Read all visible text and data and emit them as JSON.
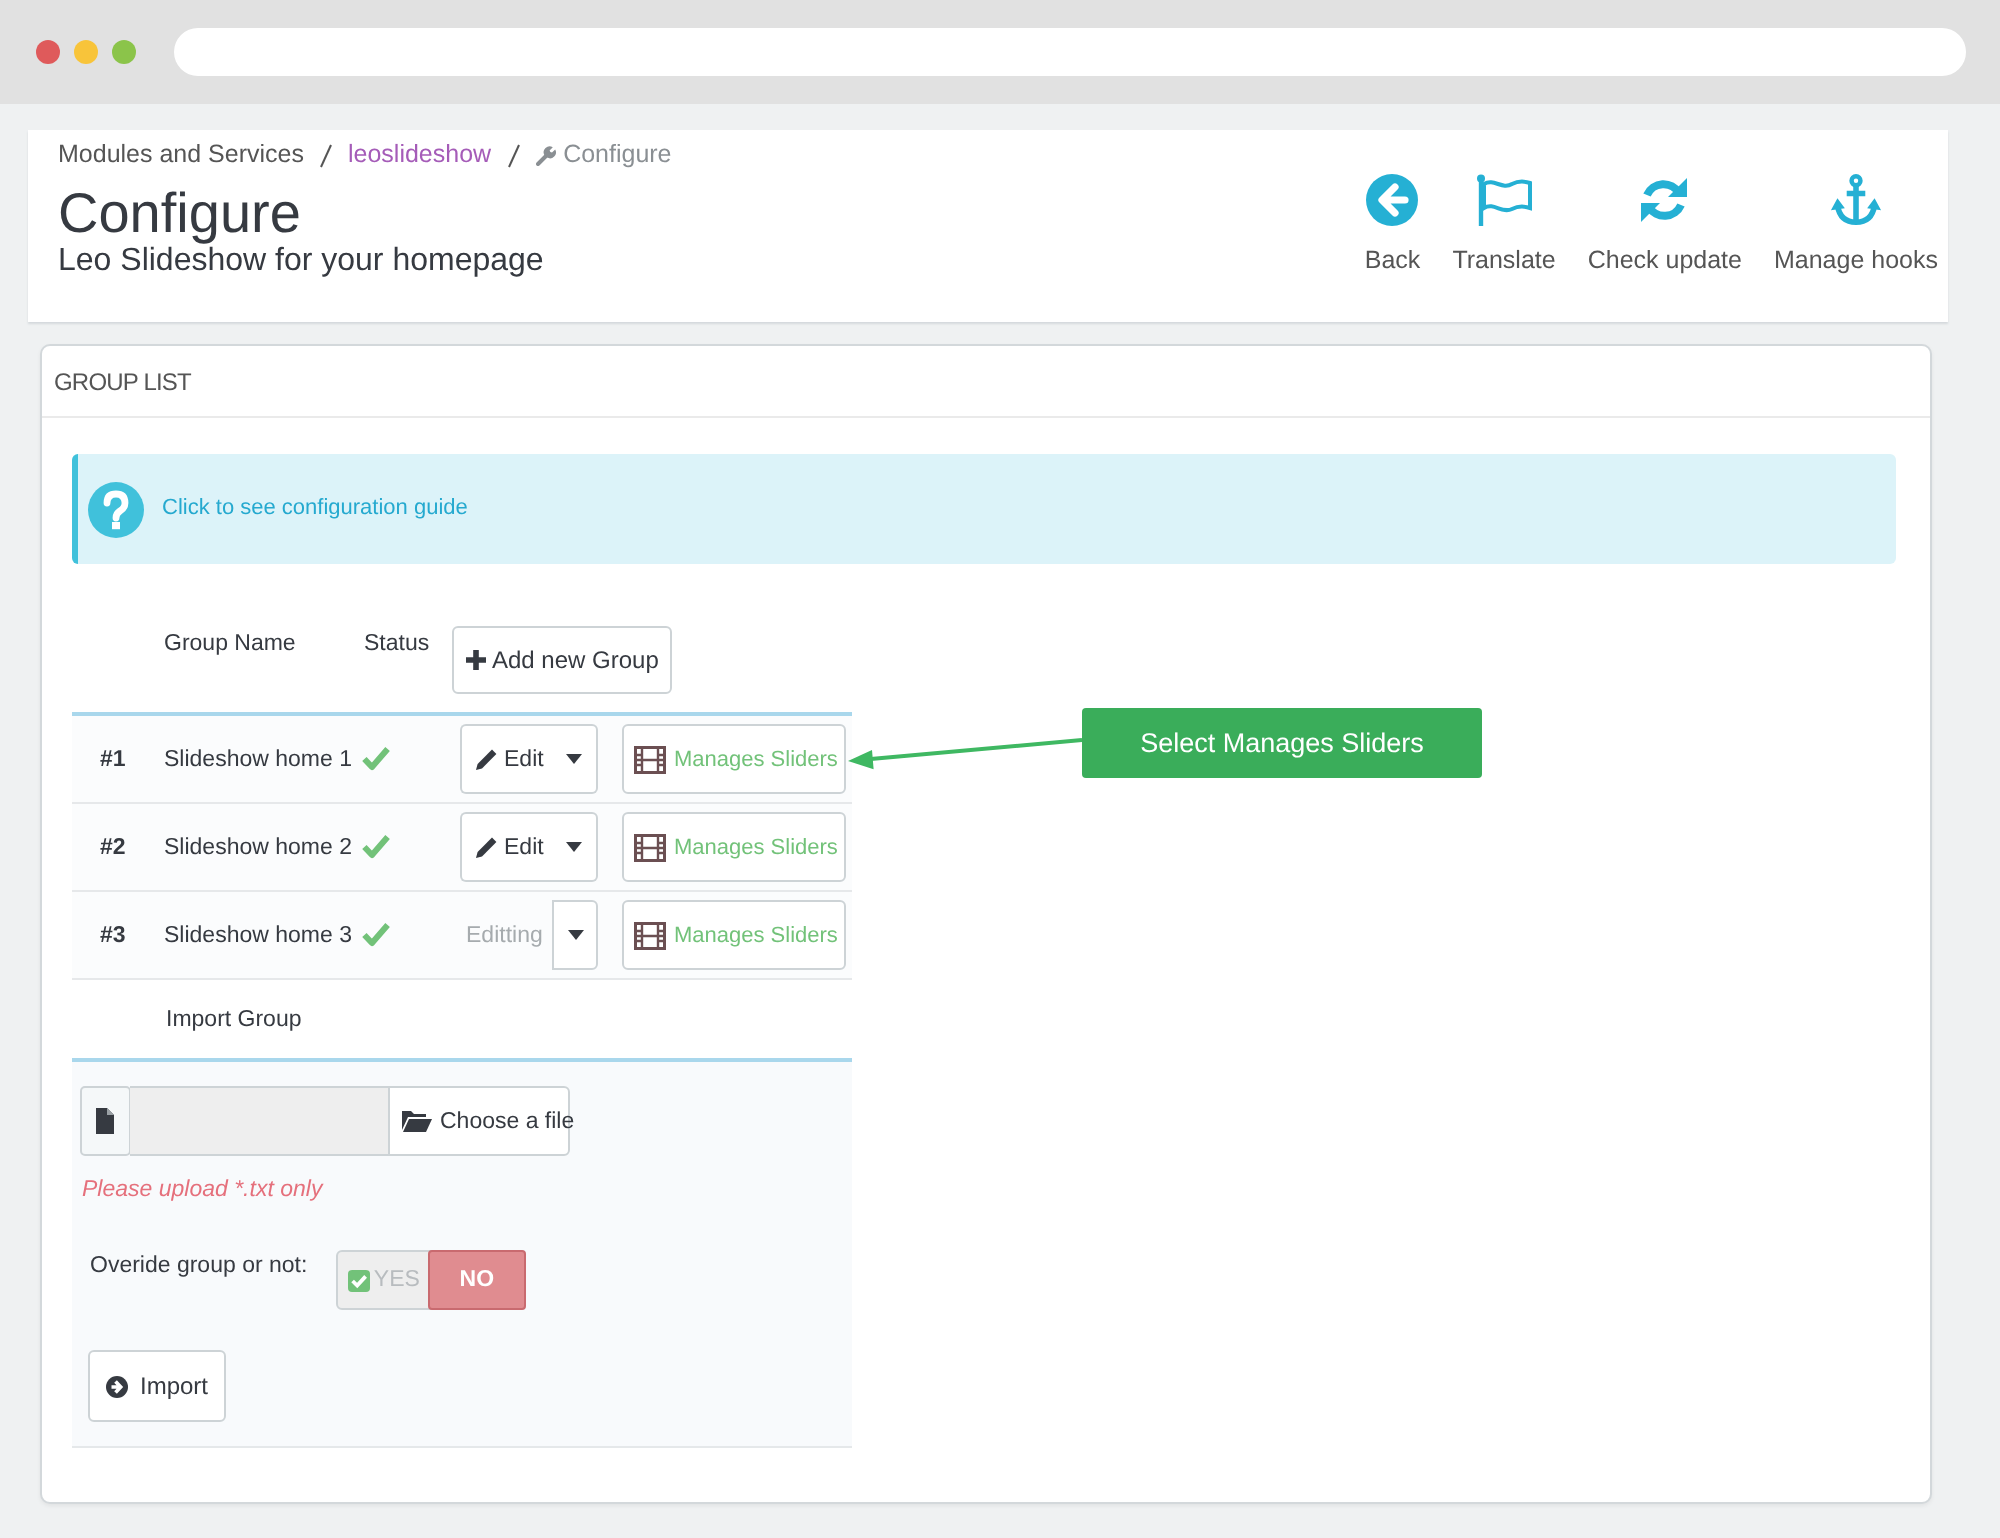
{
  "breadcrumb": [
    {
      "label": "Modules and Services",
      "kind": "link"
    },
    {
      "label": "leoslideshow",
      "kind": "visited"
    },
    {
      "label": "Configure",
      "kind": "current"
    }
  ],
  "page": {
    "title": "Configure",
    "subtitle": "Leo Slideshow for your homepage"
  },
  "toolbar": [
    {
      "label": "Back",
      "kind": "back"
    },
    {
      "label": "Translate",
      "kind": "translate"
    },
    {
      "label": "Check update",
      "kind": "update"
    },
    {
      "label": "Manage hooks",
      "kind": "hooks"
    }
  ],
  "panel": {
    "heading": "GROUP LIST",
    "alert": {
      "link": "Click to see configuration guide"
    },
    "table": {
      "columns": [
        "Group Name",
        "Status"
      ],
      "add_button": "Add new Group",
      "rows": [
        {
          "id": "#1",
          "name": "Slideshow home 1",
          "active": true,
          "edit": {
            "label": "Edit",
            "disabled": false
          },
          "sliders_button": "Manages Sliders"
        },
        {
          "id": "#2",
          "name": "Slideshow home 2",
          "active": true,
          "edit": {
            "label": "Edit",
            "disabled": false
          },
          "sliders_button": "Manages Sliders"
        },
        {
          "id": "#3",
          "name": "Slideshow home 3",
          "active": true,
          "edit": {
            "label": "Editting",
            "disabled": true
          },
          "sliders_button": "Manages Sliders"
        }
      ]
    },
    "import": {
      "heading": "Import Group",
      "file_button": "Choose a file",
      "help": "Please upload *.txt only",
      "override": {
        "label": "Overide group or not:",
        "options": [
          {
            "label": "YES",
            "kind": "yes",
            "selected": false
          },
          {
            "label": "NO",
            "kind": "no",
            "selected": true
          }
        ]
      },
      "import_button": "Import"
    }
  },
  "callout": {
    "text": "Select Manages Sliders"
  }
}
